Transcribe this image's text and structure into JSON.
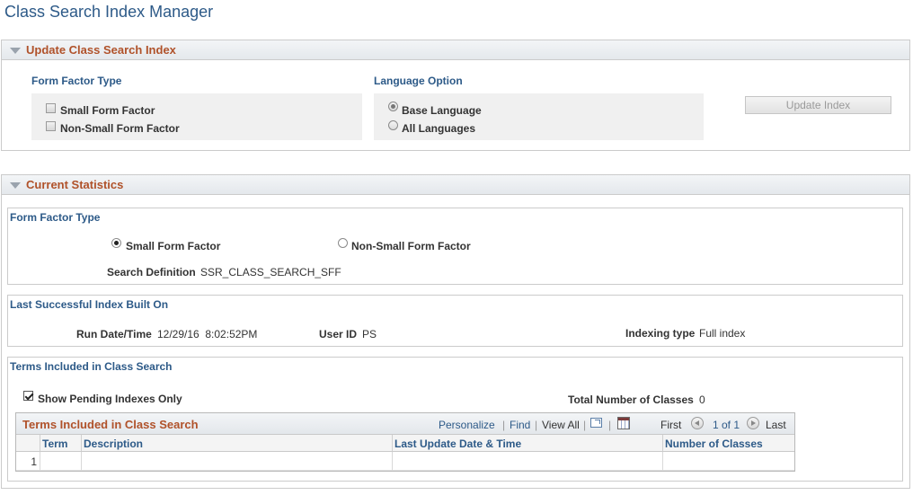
{
  "page_title": "Class Search Index Manager",
  "update_section": {
    "title": "Update Class Search Index",
    "form_factor_label": "Form Factor Type",
    "form_factor_options": [
      "Small Form Factor",
      "Non-Small Form Factor"
    ],
    "language_label": "Language Option",
    "language_options": [
      "Base Language",
      "All Languages"
    ],
    "language_selected": "Base Language",
    "update_button": "Update Index"
  },
  "stats_section": {
    "title": "Current Statistics",
    "form_factor": {
      "label": "Form Factor Type",
      "options": [
        "Small Form Factor",
        "Non-Small Form Factor"
      ],
      "selected": "Small Form Factor",
      "search_definition_label": "Search Definition",
      "search_definition_value": "SSR_CLASS_SEARCH_SFF"
    },
    "last_build": {
      "label": "Last Successful Index Built On",
      "run_date_label": "Run Date/Time",
      "run_date_value": "12/29/16  8:02:52PM",
      "user_id_label": "User ID",
      "user_id_value": "PS",
      "indexing_type_label": "Indexing type",
      "indexing_type_value": "Full index"
    },
    "terms": {
      "label": "Terms Included in Class Search",
      "show_pending_label": "Show Pending Indexes Only",
      "show_pending_checked": true,
      "total_classes_label": "Total Number of Classes",
      "total_classes_value": "0",
      "grid": {
        "title": "Terms Included in Class Search",
        "personalize": "Personalize",
        "sep": "|",
        "find": "Find",
        "view_all": "View All",
        "first": "First",
        "range": "1 of 1",
        "last": "Last",
        "columns": [
          "Term",
          "Description",
          "Last Update Date & Time",
          "Number of Classes"
        ],
        "rows": [
          {
            "num": "1",
            "term": "",
            "description": "",
            "last_update": "",
            "number_of_classes": ""
          }
        ]
      }
    }
  }
}
